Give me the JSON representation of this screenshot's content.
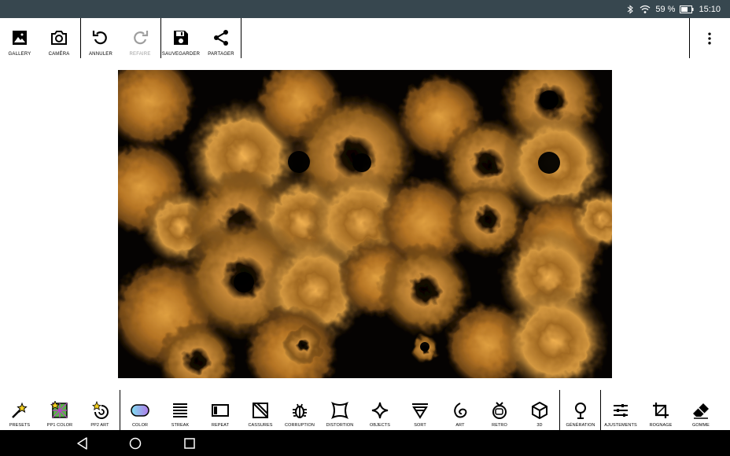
{
  "status_bar": {
    "battery": "59 %",
    "time": "15:10"
  },
  "top_toolbar": {
    "gallery": "GALLERY",
    "camera": "CAMÉRA",
    "undo": "ANNULER",
    "redo": "REFAIRE",
    "save": "SAUVEGARDER",
    "share": "PARTAGER"
  },
  "bottom_toolbar": {
    "items": [
      {
        "label": "PRESETS",
        "icon": "magic-wand-icon"
      },
      {
        "label": "PP1 COLOR",
        "icon": "pp1-color-icon"
      },
      {
        "label": "PP2 ART",
        "icon": "pp2-art-icon"
      },
      {
        "label": "COLOR",
        "icon": "color-pill-icon"
      },
      {
        "label": "STREAK",
        "icon": "streak-icon"
      },
      {
        "label": "REPEAT",
        "icon": "repeat-icon"
      },
      {
        "label": "CASSURES",
        "icon": "cassures-icon"
      },
      {
        "label": "CORRUPTION",
        "icon": "bug-icon"
      },
      {
        "label": "DISTORTION",
        "icon": "distortion-icon"
      },
      {
        "label": "OBJECTS",
        "icon": "sparkle-icon"
      },
      {
        "label": "SORT",
        "icon": "sort-icon"
      },
      {
        "label": "ART",
        "icon": "art-icon"
      },
      {
        "label": "RETRO",
        "icon": "tv-icon"
      },
      {
        "label": "3D",
        "icon": "cube-icon"
      },
      {
        "label": "GÉNÉRATION",
        "icon": "tree-icon"
      },
      {
        "label": "AJUSTEMENTS",
        "icon": "sliders-icon"
      },
      {
        "label": "ROGNAGE",
        "icon": "crop-icon"
      },
      {
        "label": "GOMME",
        "icon": "eraser-icon"
      }
    ]
  },
  "colors": {
    "status_bar": "#37474f",
    "accent_gold": "#c58a2e",
    "disabled": "#9e9e9e"
  }
}
